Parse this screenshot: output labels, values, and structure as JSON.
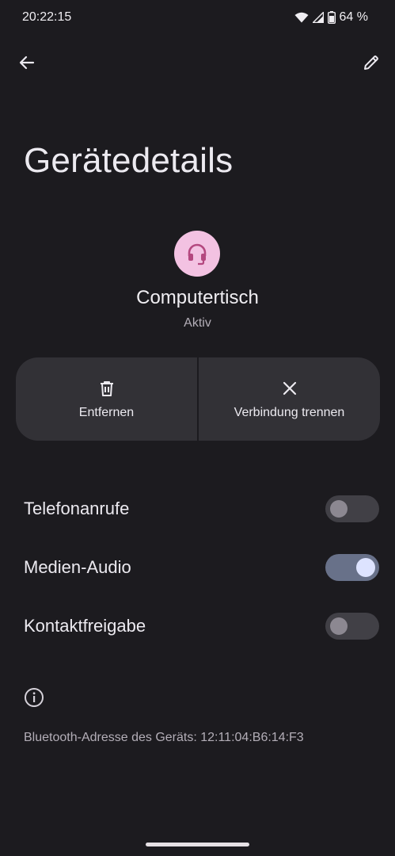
{
  "status_bar": {
    "time": "20:22:15",
    "battery": "64 %"
  },
  "header": {
    "title": "Gerätedetails",
    "back_icon": "arrow-left-icon",
    "edit_icon": "pencil-icon"
  },
  "device": {
    "name": "Computertisch",
    "status": "Aktiv",
    "icon": "headset-icon",
    "icon_bg": "#f3c2e2",
    "icon_color": "#b4487f"
  },
  "actions": [
    {
      "label": "Entfernen",
      "icon": "trash-icon"
    },
    {
      "label": "Verbindung trennen",
      "icon": "close-icon"
    }
  ],
  "settings": [
    {
      "label": "Telefonanrufe",
      "enabled": false
    },
    {
      "label": "Medien-Audio",
      "enabled": true
    },
    {
      "label": "Kontaktfreigabe",
      "enabled": false
    }
  ],
  "info": {
    "icon": "info-icon",
    "text": "Bluetooth-Adresse des Geräts: 12:11:04:B6:14:F3"
  }
}
